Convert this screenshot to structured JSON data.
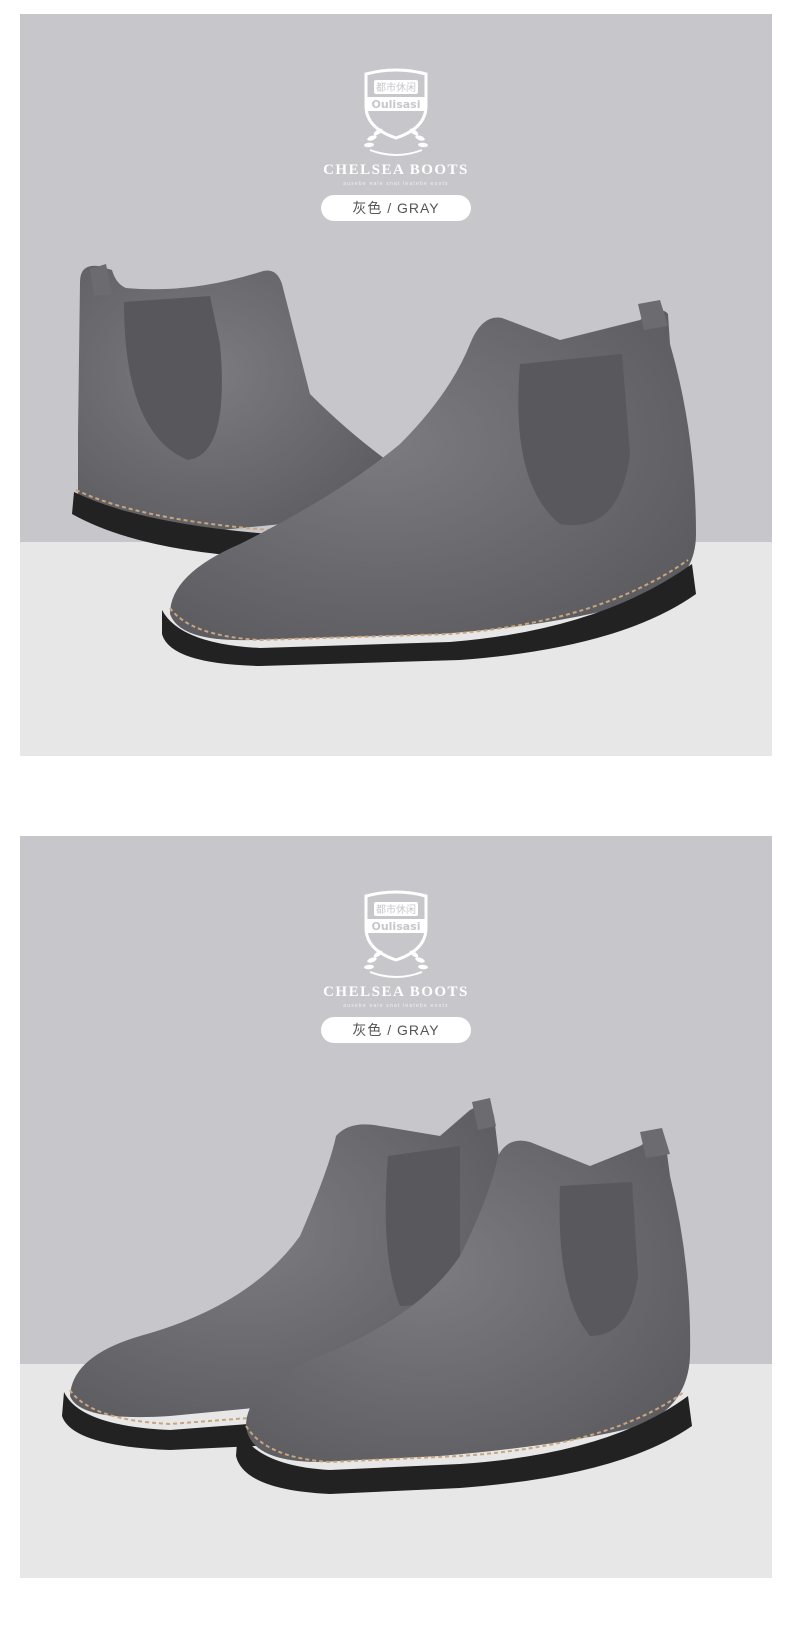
{
  "panels": [
    {
      "emblem_text_cn": "都市休闲",
      "emblem_text_en": "Oulisasi",
      "title": "CHELSEA BOOTS",
      "subtitle": "ausebe eale snat leatebe eoots",
      "color_label": "灰色 / GRAY"
    },
    {
      "emblem_text_cn": "都市休闲",
      "emblem_text_en": "Oulisasi",
      "title": "CHELSEA BOOTS",
      "subtitle": "ausebe eale snat leatebe eoots",
      "color_label": "灰色 / GRAY"
    }
  ],
  "colors": {
    "backdrop_top": "#c7c7cb",
    "backdrop_floor": "#e7e7e8",
    "suede": "#6e6e72",
    "elastic": "#58585d",
    "sole": "#222222",
    "welt_stitch": "#c8a57c"
  }
}
